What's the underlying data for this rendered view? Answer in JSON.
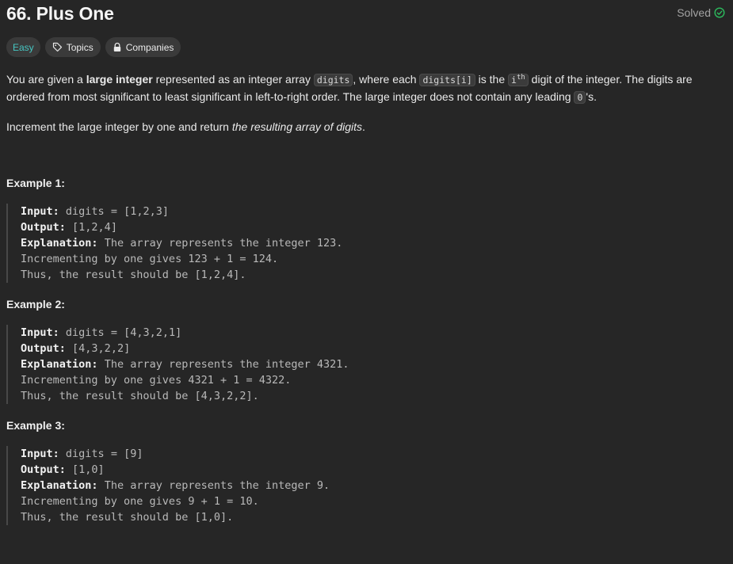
{
  "header": {
    "title": "66. Plus One",
    "status": "Solved",
    "status_color": "#2cbb5d"
  },
  "tags": {
    "difficulty": "Easy",
    "difficulty_color": "#46c6c2",
    "topics": "Topics",
    "topics_icon": "tag-icon",
    "companies": "Companies",
    "companies_icon": "lock-icon"
  },
  "description": {
    "p1": {
      "t1": "You are given a ",
      "b1": "large integer",
      "t2": " represented as an integer array ",
      "c1": "digits",
      "t3": ", where each ",
      "c2": "digits[i]",
      "t4": " is the ",
      "c3": "i",
      "c3sup": "th",
      "t5": " digit of the integer. The digits are ordered from most significant to least significant in left-to-right order. The large integer does not contain any leading ",
      "c4": "0",
      "t6": "'s."
    },
    "p2": {
      "t1": "Increment the large integer by one and return ",
      "i1": "the resulting array of digits",
      "t2": "."
    }
  },
  "examples": [
    {
      "title": "Example 1:",
      "input_label": "Input:",
      "input": "digits = [1,2,3]",
      "output_label": "Output:",
      "output": "[1,2,4]",
      "explanation_label": "Explanation:",
      "explanation": [
        "The array represents the integer 123.",
        "Incrementing by one gives 123 + 1 = 124.",
        "Thus, the result should be [1,2,4]."
      ]
    },
    {
      "title": "Example 2:",
      "input_label": "Input:",
      "input": "digits = [4,3,2,1]",
      "output_label": "Output:",
      "output": "[4,3,2,2]",
      "explanation_label": "Explanation:",
      "explanation": [
        "The array represents the integer 4321.",
        "Incrementing by one gives 4321 + 1 = 4322.",
        "Thus, the result should be [4,3,2,2]."
      ]
    },
    {
      "title": "Example 3:",
      "input_label": "Input:",
      "input": "digits = [9]",
      "output_label": "Output:",
      "output": "[1,0]",
      "explanation_label": "Explanation:",
      "explanation": [
        "The array represents the integer 9.",
        "Incrementing by one gives 9 + 1 = 10.",
        "Thus, the result should be [1,0]."
      ]
    }
  ]
}
